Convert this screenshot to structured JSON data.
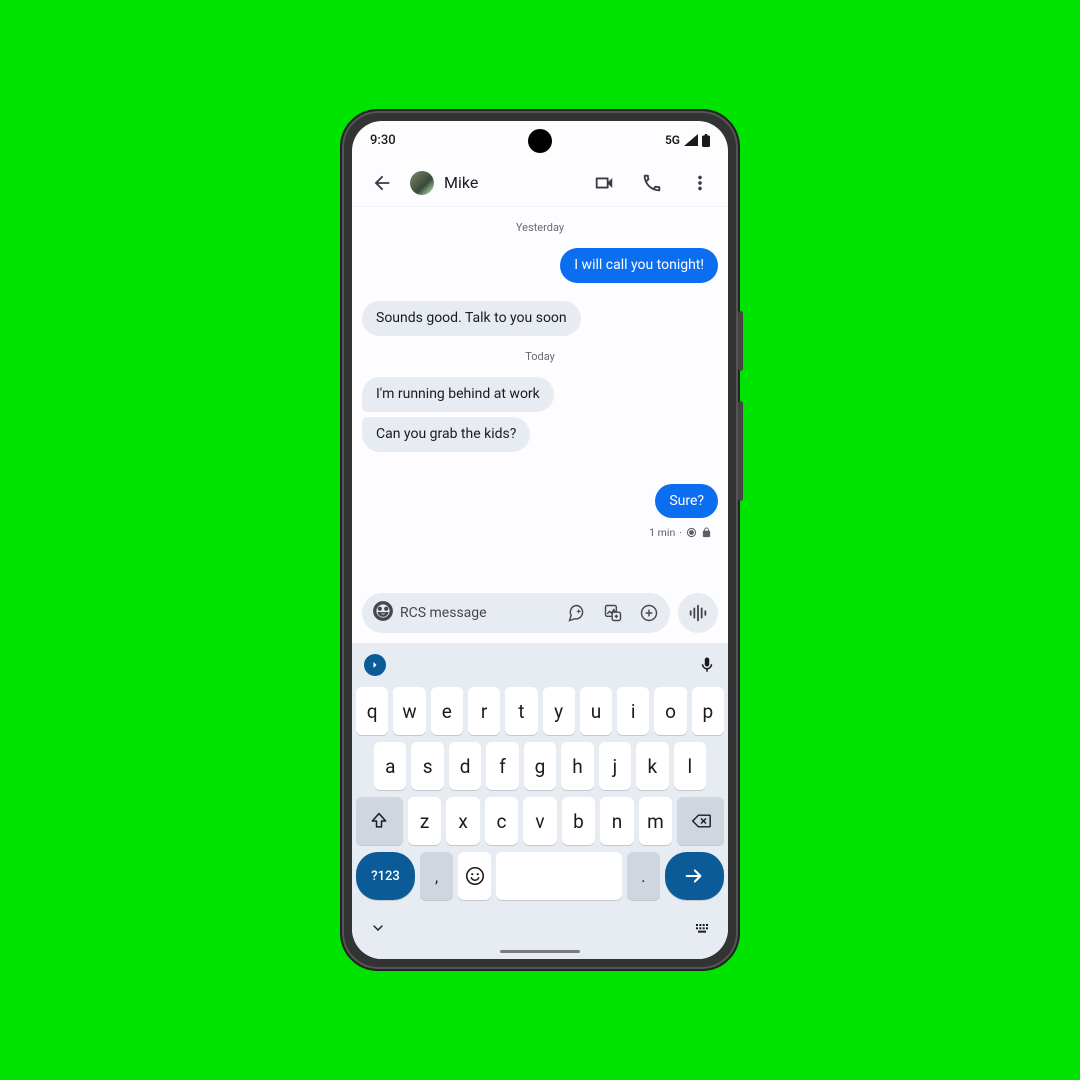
{
  "status": {
    "time": "9:30",
    "network": "5G"
  },
  "header": {
    "contact_name": "Mike"
  },
  "conversation": {
    "sep1": "Yesterday",
    "m1": "I will call you tonight!",
    "m2": "Sounds good. Talk to you soon",
    "sep2": "Today",
    "m3": "I'm running behind at work",
    "m4": "Can you grab the kids?",
    "m5": "Sure?",
    "meta_time": "1 min",
    "meta_dot": "·"
  },
  "composer": {
    "placeholder": "RCS message"
  },
  "keyboard": {
    "row1": [
      "q",
      "w",
      "e",
      "r",
      "t",
      "y",
      "u",
      "i",
      "o",
      "p"
    ],
    "row2": [
      "a",
      "s",
      "d",
      "f",
      "g",
      "h",
      "j",
      "k",
      "l"
    ],
    "row3": [
      "z",
      "x",
      "c",
      "v",
      "b",
      "n",
      "m"
    ],
    "sym": "?123",
    "comma": ",",
    "period": "."
  }
}
